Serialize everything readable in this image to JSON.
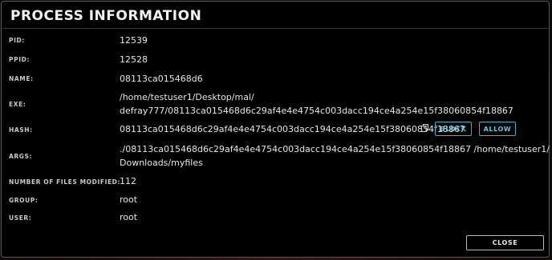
{
  "dialog": {
    "title": "PROCESS INFORMATION",
    "close_label": "CLOSE"
  },
  "fields": {
    "pid": {
      "label": "PID:",
      "value": "12539"
    },
    "ppid": {
      "label": "PPID:",
      "value": "12528"
    },
    "name": {
      "label": "NAME:",
      "value": "08113ca015468d6"
    },
    "exe": {
      "label": "EXE:",
      "line1": "/home/testuser1/Desktop/mal/",
      "line2": "defray777/08113ca015468d6c29af4e4e4754c003dacc194ce4a254e15f38060854f18867"
    },
    "hash": {
      "label": "HASH:",
      "value": "08113ca015468d6c29af4e4e4754c003dacc194ce4a254e15f38060854f18867",
      "copy_icon": "copy-icon",
      "block_label": "BLOCK",
      "allow_label": "ALLOW"
    },
    "args": {
      "label": "ARGS:",
      "line1": "./08113ca015468d6c29af4e4e4754c003dacc194ce4a254e15f38060854f18867 /home/testuser1/",
      "line2": "Downloads/myfiles"
    },
    "files_modified": {
      "label": "NUMBER OF FILES MODIFIED:",
      "value": "112"
    },
    "group": {
      "label": "GROUP:",
      "value": "root"
    },
    "user": {
      "label": "USER:",
      "value": "root"
    }
  },
  "colors": {
    "background": "#000000",
    "accent": "#5ccbe0",
    "text": "#e6e6e6",
    "label": "#c9c9c9"
  }
}
